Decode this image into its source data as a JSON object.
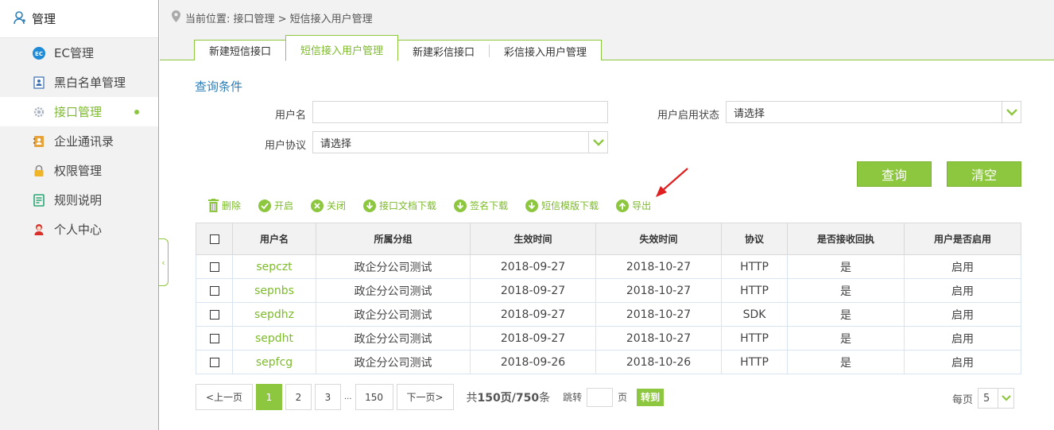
{
  "sidebar": {
    "header": "管理",
    "items": [
      {
        "label": "EC管理",
        "icon": "ec-icon"
      },
      {
        "label": "黑白名单管理",
        "icon": "contact-card-icon"
      },
      {
        "label": "接口管理",
        "icon": "gear-icon",
        "active": true
      },
      {
        "label": "企业通讯录",
        "icon": "address-book-icon"
      },
      {
        "label": "权限管理",
        "icon": "lock-icon"
      },
      {
        "label": "规则说明",
        "icon": "document-icon"
      },
      {
        "label": "个人中心",
        "icon": "person-icon"
      }
    ]
  },
  "breadcrumb": {
    "text": "当前位置: 接口管理 > 短信接入用户管理"
  },
  "tabs": [
    "新建短信接口",
    "短信接入用户管理",
    "新建彩信接口",
    "彩信接入用户管理"
  ],
  "query": {
    "title": "查询条件",
    "username_label": "用户名",
    "username_value": "",
    "status_label": "用户启用状态",
    "status_value": "请选择",
    "protocol_label": "用户协议",
    "protocol_value": "请选择",
    "search_label": "查询",
    "clear_label": "清空"
  },
  "toolbar": {
    "delete": "删除",
    "enable": "开启",
    "close": "关闭",
    "doc_download": "接口文档下载",
    "sign_download": "签名下载",
    "template_download": "短信模版下载",
    "export": "导出"
  },
  "table": {
    "headers": [
      "用户名",
      "所属分组",
      "生效时间",
      "失效时间",
      "协议",
      "是否接收回执",
      "用户是否启用"
    ],
    "rows": [
      [
        "sepczt",
        "政企分公司测试",
        "2018-09-27",
        "2018-10-27",
        "HTTP",
        "是",
        "启用"
      ],
      [
        "sepnbs",
        "政企分公司测试",
        "2018-09-27",
        "2018-10-27",
        "HTTP",
        "是",
        "启用"
      ],
      [
        "sepdhz",
        "政企分公司测试",
        "2018-09-27",
        "2018-10-27",
        "SDK",
        "是",
        "启用"
      ],
      [
        "sepdht",
        "政企分公司测试",
        "2018-09-27",
        "2018-10-27",
        "HTTP",
        "是",
        "启用"
      ],
      [
        "sepfcg",
        "政企分公司测试",
        "2018-09-26",
        "2018-10-26",
        "HTTP",
        "是",
        "启用"
      ]
    ]
  },
  "pager": {
    "prev": "<上一页",
    "pages": [
      "1",
      "2",
      "3"
    ],
    "ellipsis": "...",
    "last": "150",
    "next": "下一页>",
    "total_prefix": "共",
    "total_pages": "150",
    "total_mid": "页/",
    "total_records": "750",
    "total_suffix": "条",
    "jump_label": "跳转",
    "page_label": "页",
    "go": "转到",
    "per_page_label": "每页",
    "per_page_value": "5"
  },
  "colors": {
    "accent": "#8dc63f",
    "link_blue": "#2e7fb8",
    "annotation_red": "#e02020"
  }
}
